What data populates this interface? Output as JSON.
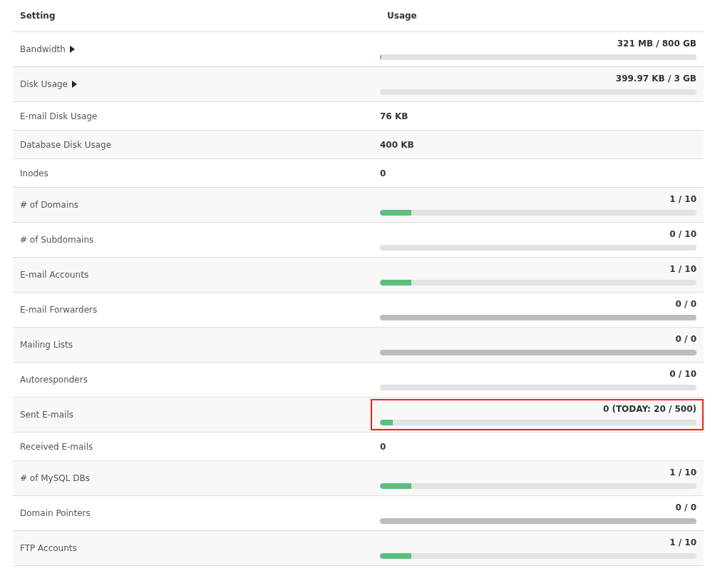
{
  "table": {
    "columns": [
      "Setting",
      "Usage"
    ],
    "rows": [
      {
        "setting": "Bandwidth",
        "expandable": true,
        "kind": "bar",
        "usage": "321 MB / 800 GB",
        "level": 0.004,
        "disabled": false,
        "highlighted": false
      },
      {
        "setting": "Disk Usage",
        "expandable": true,
        "kind": "bar",
        "usage": "399.97 KB / 3 GB",
        "disabled": false,
        "highlighted": false
      },
      {
        "setting": "E-mail Disk Usage",
        "expandable": false,
        "kind": "plain",
        "usage": "76 KB"
      },
      {
        "setting": "Database Disk Usage",
        "expandable": false,
        "kind": "plain",
        "usage": "400 KB"
      },
      {
        "setting": "Inodes",
        "expandable": false,
        "kind": "plain",
        "usage": "0"
      },
      {
        "setting": "# of Domains",
        "expandable": false,
        "kind": "bar",
        "usage": "1 / 10",
        "level": 0.1,
        "disabled": false,
        "highlighted": false
      },
      {
        "setting": "# of Subdomains",
        "expandable": false,
        "kind": "bar",
        "usage": "0 / 10",
        "disabled": false,
        "highlighted": false
      },
      {
        "setting": "E-mail Accounts",
        "expandable": false,
        "kind": "bar",
        "usage": "1 / 10",
        "level": 0.1,
        "disabled": false,
        "highlighted": false
      },
      {
        "setting": "E-mail Forwarders",
        "expandable": false,
        "kind": "bar",
        "usage": "0 / 0",
        "disabled": true,
        "highlighted": false
      },
      {
        "setting": "Mailing Lists",
        "expandable": false,
        "kind": "bar",
        "usage": "0 / 0",
        "disabled": true,
        "highlighted": false
      },
      {
        "setting": "Autoresponders",
        "expandable": false,
        "kind": "bar",
        "usage": "0 / 10",
        "disabled": false,
        "highlighted": false
      },
      {
        "setting": "Sent E-mails",
        "expandable": false,
        "kind": "bar",
        "usage": "0 (TODAY: 20 / 500)",
        "level": 0.04,
        "disabled": false,
        "highlighted": true
      },
      {
        "setting": "Received E-mails",
        "expandable": false,
        "kind": "plain",
        "usage": "0"
      },
      {
        "setting": "# of MySQL DBs",
        "expandable": false,
        "kind": "bar",
        "usage": "1 / 10",
        "level": 0.1,
        "disabled": false,
        "highlighted": false
      },
      {
        "setting": "Domain Pointers",
        "expandable": false,
        "kind": "bar",
        "usage": "0 / 0",
        "disabled": true,
        "highlighted": false
      },
      {
        "setting": "FTP Accounts",
        "expandable": false,
        "kind": "bar",
        "usage": "1 / 10",
        "level": 0.1,
        "disabled": false,
        "highlighted": false
      }
    ]
  }
}
